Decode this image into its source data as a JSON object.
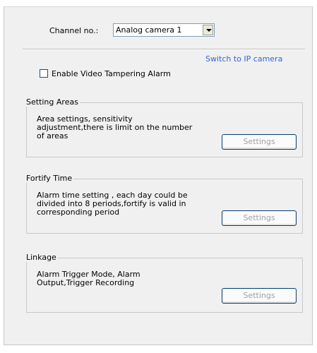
{
  "channel": {
    "label": "Channel no.:",
    "selected": "Analog camera 1"
  },
  "switch_link": "Switch to IP camera",
  "enable_tampering": {
    "label": "Enable Video Tampering Alarm",
    "checked": false
  },
  "groups": [
    {
      "title": "Setting Areas",
      "desc_lines": [
        "Area settings, sensitivity",
        "adjustment,there is limit on the number",
        "of areas"
      ],
      "button": "Settings"
    },
    {
      "title": "Fortify Time",
      "desc_lines": [
        "Alarm time setting , each day could be",
        "divided into 8 periods,fortify is valid in",
        "corresponding period"
      ],
      "button": "Settings"
    },
    {
      "title": "Linkage",
      "desc_lines": [
        "Alarm Trigger Mode, Alarm",
        "Output,Trigger Recording"
      ],
      "button": "Settings"
    }
  ],
  "colors": {
    "panel_bg": "#f0f0f0",
    "link": "#3366cc",
    "button_border": "#003c74",
    "disabled_text": "#a0a0a0"
  }
}
